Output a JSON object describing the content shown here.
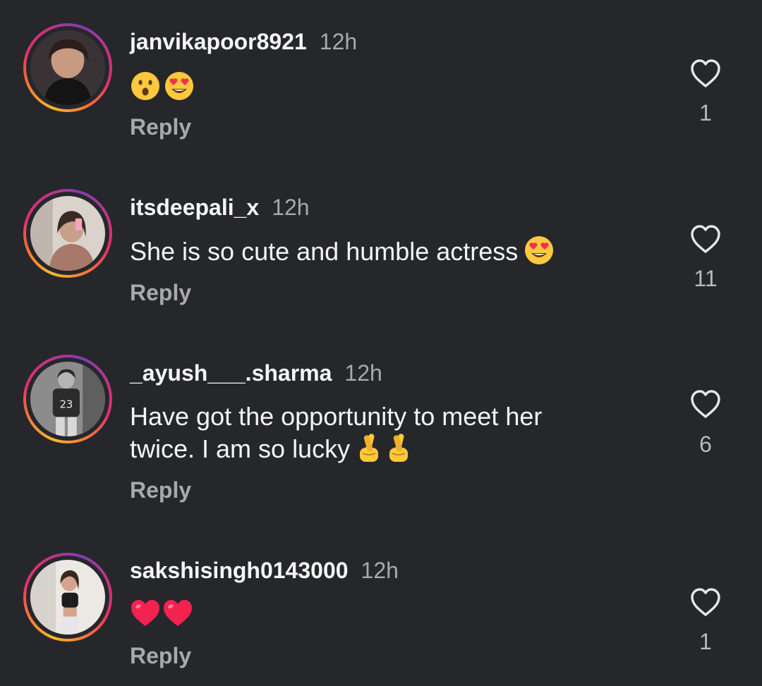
{
  "comments": [
    {
      "username": "janvikapoor8921",
      "time": "12h",
      "text": "",
      "emojis": [
        "hushed-face-emoji",
        "heart-eyes-emoji"
      ],
      "reply_label": "Reply",
      "likes": "1"
    },
    {
      "username": "itsdeepali_x",
      "time": "12h",
      "text": "She is so cute and humble actress",
      "emojis": [
        "heart-eyes-emoji"
      ],
      "reply_label": "Reply",
      "likes": "11"
    },
    {
      "username": "_ayush___.sharma",
      "time": "12h",
      "text": "Have got the opportunity to meet her twice. I am so lucky",
      "emojis": [
        "crossed-fingers-emoji",
        "crossed-fingers-emoji"
      ],
      "reply_label": "Reply",
      "likes": "6"
    },
    {
      "username": "sakshisingh0143000",
      "time": "12h",
      "text": "",
      "emojis": [
        "red-heart-emoji",
        "red-heart-emoji"
      ],
      "reply_label": "Reply",
      "likes": "1"
    }
  ],
  "icons": {
    "like": "heart-outline-icon"
  },
  "colors": {
    "background": "#26272b",
    "secondary_text": "#a8a8ad",
    "story_ring_start": "#f9b72d",
    "story_ring_end": "#c13584"
  }
}
